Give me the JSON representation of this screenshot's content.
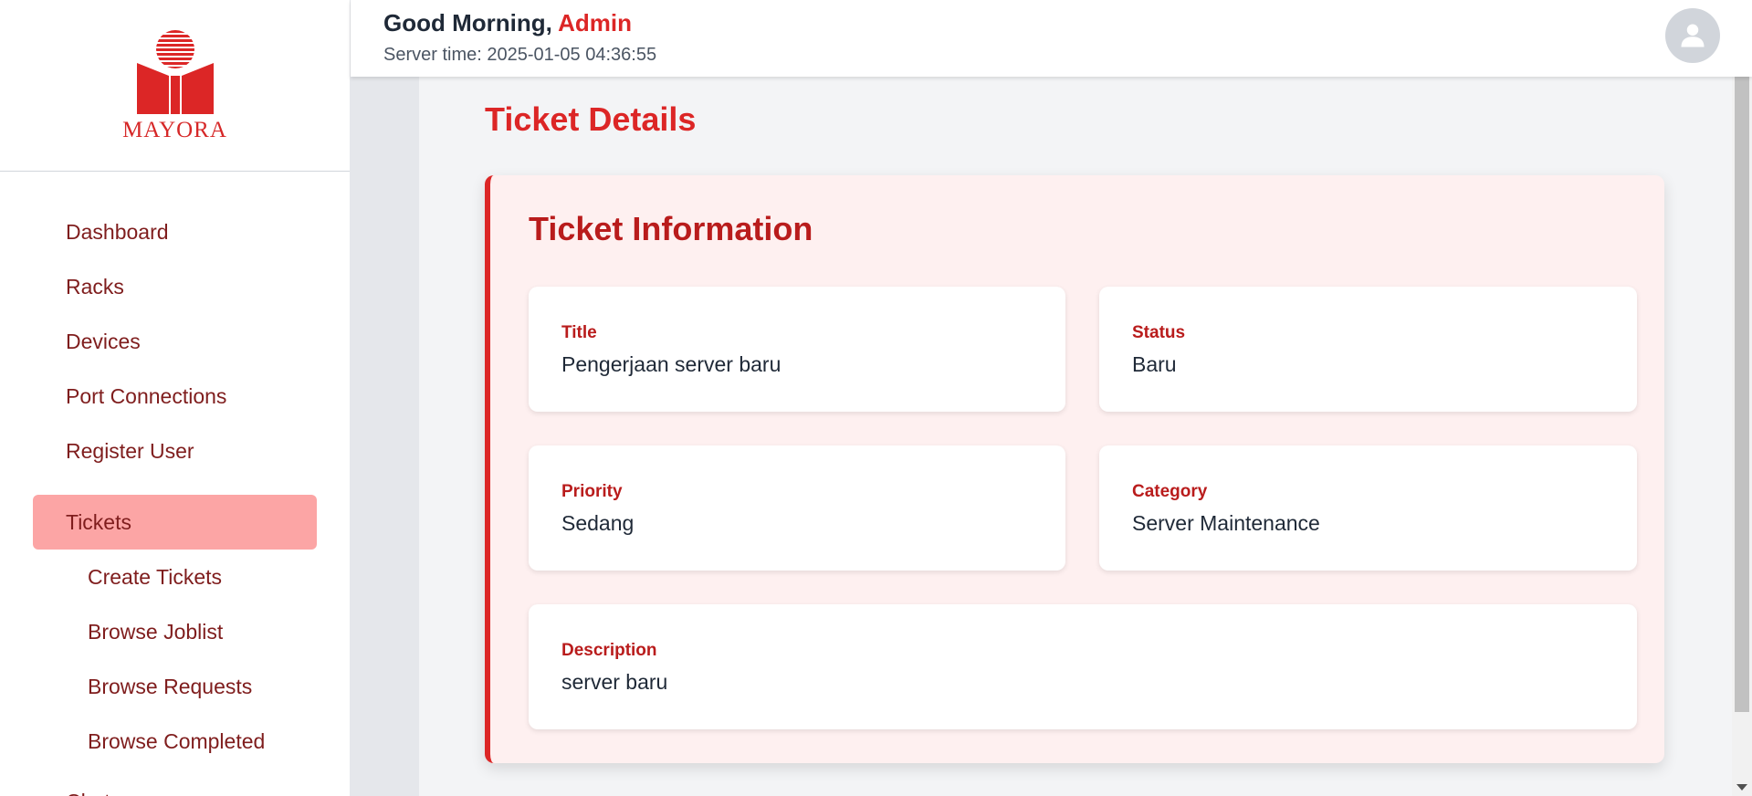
{
  "brand": {
    "logo_text": "MAYORA",
    "color": "#dc2626"
  },
  "header": {
    "greeting": "Good Morning,",
    "user_name": "Admin",
    "server_time": "Server time: 2025-01-05 04:36:55"
  },
  "sidebar": {
    "items": [
      {
        "label": "Dashboard"
      },
      {
        "label": "Racks"
      },
      {
        "label": "Devices"
      },
      {
        "label": "Port Connections"
      },
      {
        "label": "Register User"
      },
      {
        "label": "Tickets",
        "active": true
      }
    ],
    "sub_items": [
      {
        "label": "Create Tickets"
      },
      {
        "label": "Browse Joblist"
      },
      {
        "label": "Browse Requests"
      },
      {
        "label": "Browse Completed"
      }
    ],
    "cutoff_item": "Chat"
  },
  "main": {
    "page_title": "Ticket Details",
    "card_title": "Ticket Information",
    "fields": {
      "title": {
        "label": "Title",
        "value": "Pengerjaan server baru"
      },
      "status": {
        "label": "Status",
        "value": "Baru"
      },
      "priority": {
        "label": "Priority",
        "value": "Sedang"
      },
      "category": {
        "label": "Category",
        "value": "Server Maintenance"
      },
      "description": {
        "label": "Description",
        "value": "server baru"
      }
    }
  }
}
